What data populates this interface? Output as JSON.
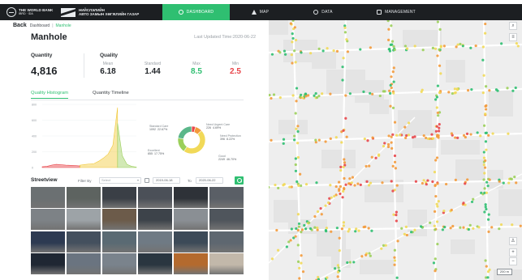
{
  "header": {
    "logo_primary": "THE WORLD BANK",
    "logo_primary_sub": "IBRD · IDA",
    "logo_secondary_line1": "НИЙСЛЭЛИЙН",
    "logo_secondary_line2": "АВТО ЗАМЫН ХӨГЖЛИЙН ГАЗАР",
    "nav": [
      {
        "label": "DASHBOARD",
        "icon": "gauge-icon",
        "active": true
      },
      {
        "label": "MAP",
        "icon": "map-pin-icon",
        "active": false
      },
      {
        "label": "DATA",
        "icon": "database-icon",
        "active": false
      },
      {
        "label": "MANAGEMENT",
        "icon": "grid-icon",
        "active": false
      }
    ]
  },
  "breadcrumb": {
    "back": "Back",
    "parent": "Dashboard",
    "current": "Manhole"
  },
  "page": {
    "title": "Manhole",
    "last_updated": "Last Updated Time:2020-06-22"
  },
  "quantity": {
    "label": "Quantity",
    "value": "4,816"
  },
  "quality": {
    "label": "Quality",
    "stats": [
      {
        "label": "Mean",
        "value": "6.18",
        "color": "#1f2327"
      },
      {
        "label": "Standard",
        "value": "1.44",
        "color": "#1f2327"
      },
      {
        "label": "Max",
        "value": "8.5",
        "color": "#2fbf71"
      },
      {
        "label": "Min",
        "value": "2.5",
        "color": "#e8454a"
      }
    ]
  },
  "tabs": [
    {
      "label": "Quality Histogram",
      "active": true
    },
    {
      "label": "Quantity Timeline",
      "active": false
    }
  ],
  "chart_data": [
    {
      "type": "area",
      "yticks": [
        "800",
        "600",
        "400",
        "200",
        "0"
      ],
      "ylim": [
        0,
        800
      ],
      "series": [
        {
          "color": "#e8454a",
          "x": [
            0,
            5,
            10,
            15,
            20,
            25,
            30,
            35,
            40
          ],
          "values": [
            10,
            15,
            30,
            40,
            35,
            30,
            28,
            25,
            20
          ]
        },
        {
          "color": "#f1c93a",
          "x": [
            40,
            45,
            50,
            55,
            60,
            65,
            70,
            75,
            80
          ],
          "values": [
            30,
            38,
            45,
            50,
            80,
            120,
            170,
            280,
            760
          ]
        },
        {
          "color": "#9bcf5a",
          "x": [
            80,
            85,
            90,
            95,
            100
          ],
          "values": [
            560,
            150,
            40,
            15,
            5
          ]
        }
      ]
    },
    {
      "type": "pie",
      "slices": [
        {
          "name": "Need Urgent Care",
          "count": "226",
          "percent": "4.69%",
          "value": 4.69,
          "color": "#e8454a"
        },
        {
          "name": "Need Protection",
          "count": "396",
          "percent": "8.22%",
          "value": 8.22,
          "color": "#f39a3b"
        },
        {
          "name": "Good",
          "count": "2249",
          "percent": "46.70%",
          "value": 46.7,
          "color": "#f1d958"
        },
        {
          "name": "Excellent",
          "count": "855",
          "percent": "17.75%",
          "value": 17.75,
          "color": "#9bcf5a"
        },
        {
          "name": "Standard Care",
          "count": "1092",
          "percent": "22.67%",
          "value": 22.67,
          "color": "#5bb78a"
        }
      ]
    }
  ],
  "streetview": {
    "title": "Streetview",
    "filter_label": "Filter By",
    "filter_value": "Select",
    "date_from": "2019-06-18",
    "to_label": "To",
    "date_to": "2020-06-22",
    "thumbs": [
      "#6b7072",
      "#5d6360",
      "#3a3f46",
      "#4b5058",
      "#2e3238",
      "#5a5f66",
      "#7d8286",
      "#9da3a7",
      "#6c5b4a",
      "#3d434a",
      "#8a8f94",
      "#4f555c",
      "#2d3a52",
      "#44505e",
      "#5a6a73",
      "#6f7a84",
      "#3c4a58",
      "#5e6770",
      "#1f2733",
      "#6a7480",
      "#7a838c",
      "#2a3640",
      "#b46a2e",
      "#c2b8aa"
    ]
  },
  "map": {
    "roads": "#ffffff",
    "zoom_in": "+",
    "zoom_out": "−",
    "scale_label": "200 m",
    "dot_colors": [
      "#2fbf71",
      "#9bcf5a",
      "#f1d958",
      "#f39a3b",
      "#e8454a"
    ]
  }
}
